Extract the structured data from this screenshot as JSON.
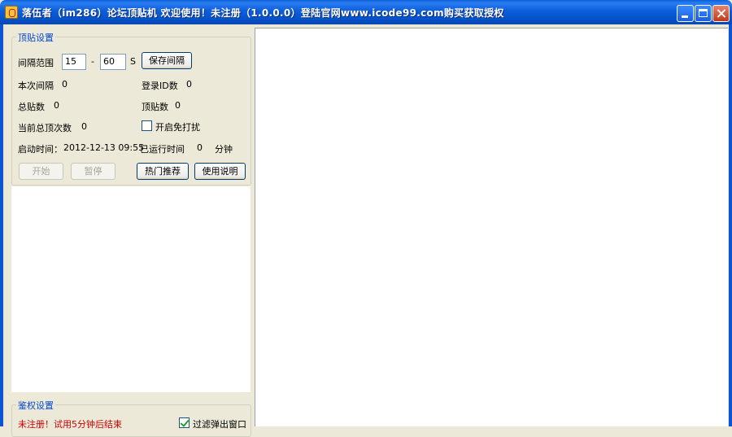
{
  "window": {
    "title": "落伍者（im286）论坛顶贴机  欢迎使用！未注册（1.0.0.0）登陆官网www.icode99.com购买获取授权"
  },
  "settings": {
    "group_title": "顶贴设置",
    "interval_label": "间隔范围",
    "interval_min": "15",
    "interval_sep": "-",
    "interval_max": "60",
    "interval_unit": "S",
    "save_interval_label": "保存间隔",
    "this_interval_label": "本次间隔",
    "this_interval_value": "0",
    "login_id_label": "登录ID数",
    "login_id_value": "0",
    "total_posts_label": "总贴数",
    "total_posts_value": "0",
    "bump_posts_label": "顶贴数",
    "bump_posts_value": "0",
    "current_bumps_label": "当前总顶次数",
    "current_bumps_value": "0",
    "no_disturb_label": "开启免打扰",
    "start_time_label": "启动时间：",
    "start_time_value": "2012-12-13 09:55",
    "run_time_label": "已运行时间",
    "run_time_value": "0",
    "run_time_unit": "分钟",
    "start_label": "开始",
    "pause_label": "暂停",
    "hot_label": "热门推荐",
    "help_label": "使用说明"
  },
  "auth": {
    "group_title": "鉴权设置",
    "status_text": "未注册！试用5分钟后结束",
    "status_color": "#cc0000",
    "filter_popup_label": "过滤弹出窗口",
    "filter_popup_checked": true
  },
  "colors": {
    "title_bar": "#0a5fd8",
    "group_title": "#0046d5"
  },
  "icons": {
    "app": "app-icon",
    "minimize": "minimize-icon",
    "maximize": "maximize-icon",
    "close": "close-icon"
  }
}
